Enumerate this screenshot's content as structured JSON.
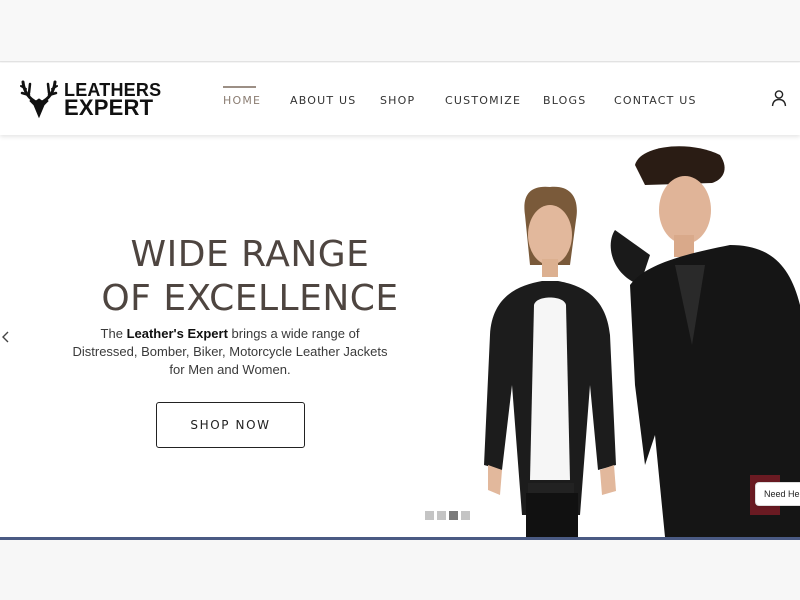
{
  "brand": {
    "line1": "LEATHERS",
    "line2": "EXPERT"
  },
  "nav": {
    "items": [
      {
        "label": "HOME",
        "active": true
      },
      {
        "label": "ABOUT US"
      },
      {
        "label": "SHOP"
      },
      {
        "label": "CUSTOMIZE"
      },
      {
        "label": "BLOGS"
      },
      {
        "label": "CONTACT US"
      }
    ]
  },
  "hero": {
    "title_line1": "WIDE RANGE",
    "title_line2": "OF EXCELLENCE",
    "desc_prefix": "The ",
    "desc_brand": "Leather's Expert",
    "desc_line1_rest": " brings a wide range of",
    "desc_line2": "Distressed, Bomber, Biker, Motorcycle Leather Jackets",
    "desc_line3": "for Men and Women.",
    "cta_label": "SHOP NOW",
    "slide_count": 4,
    "active_slide": 3
  },
  "help": {
    "label": "Need Help"
  },
  "colors": {
    "title": "#4e4540",
    "nav_active": "#8b7d72",
    "strip": "#4a5a83"
  },
  "icons": {
    "logo": "deer-antlers-icon",
    "user": "user-icon",
    "prev": "chevron-left-icon"
  }
}
